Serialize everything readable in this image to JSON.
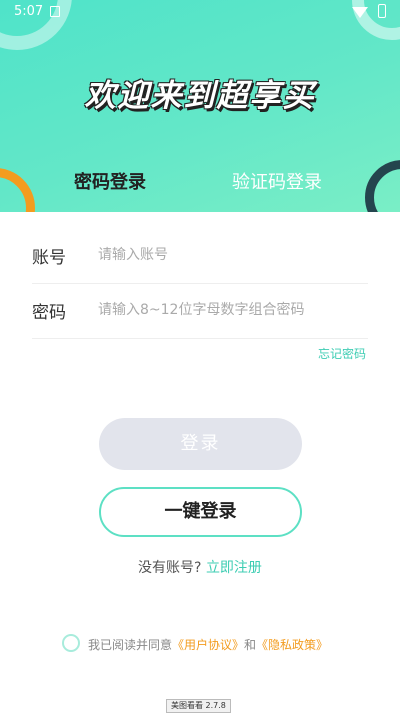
{
  "status_bar": {
    "time": "5:07"
  },
  "header": {
    "title": "欢迎来到超享买",
    "tabs": [
      {
        "label": "密码登录",
        "active": true
      },
      {
        "label": "验证码登录",
        "active": false
      }
    ]
  },
  "form": {
    "account": {
      "label": "账号",
      "placeholder": "请输入账号",
      "value": ""
    },
    "password": {
      "label": "密码",
      "placeholder": "请输入8~12位字母数字组合密码",
      "value": ""
    },
    "forgot": "忘记密码"
  },
  "buttons": {
    "login": "登录",
    "one_key": "一键登录"
  },
  "register": {
    "prompt": "没有账号?",
    "link": "立即注册"
  },
  "agreement": {
    "prefix": "我已阅读并同意",
    "user_agreement": "《用户协议》",
    "and": "和",
    "privacy_policy": "《隐私政策》",
    "checked": false
  },
  "version_badge": "美图看看 2.7.8",
  "colors": {
    "accent": "#3ecdb3",
    "header_gradient_start": "#4fe3c9",
    "header_gradient_end": "#7aeec6",
    "highlight": "#f39c1f",
    "disabled_button": "#e2e4ec"
  }
}
